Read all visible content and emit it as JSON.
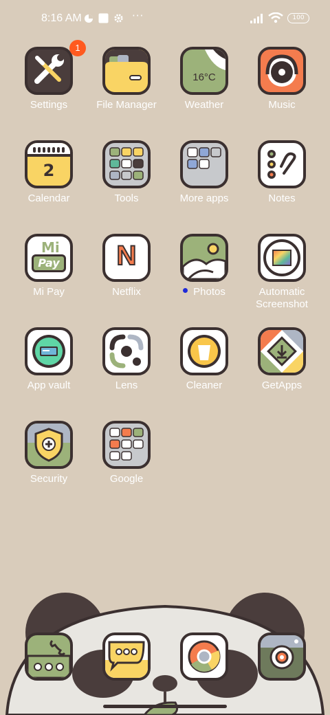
{
  "status_bar": {
    "time": "8:16 AM",
    "battery": "100",
    "more": "···"
  },
  "apps": [
    {
      "label": "Settings",
      "badge": "1"
    },
    {
      "label": "File Manager"
    },
    {
      "label": "Weather",
      "temp": "16°C"
    },
    {
      "label": "Music"
    },
    {
      "label": "Calendar",
      "date": "2"
    },
    {
      "label": "Tools"
    },
    {
      "label": "More apps"
    },
    {
      "label": "Notes"
    },
    {
      "label": "Mi Pay",
      "mi_text": "Mi",
      "pay_text": "Pay"
    },
    {
      "label": "Netflix",
      "letter": "N"
    },
    {
      "label": "Photos"
    },
    {
      "label": "Automatic Screenshot"
    },
    {
      "label": "App vault"
    },
    {
      "label": "Lens"
    },
    {
      "label": "Cleaner"
    },
    {
      "label": "GetApps"
    },
    {
      "label": "Security"
    },
    {
      "label": "Google"
    }
  ],
  "colors": {
    "background": "#d9ccbb",
    "outline": "#3b3030",
    "yellow": "#f9d464",
    "orange": "#f47c4e",
    "green": "#9cb27a",
    "badge": "#ff5a1f",
    "new_dot": "#1f2ad8"
  }
}
